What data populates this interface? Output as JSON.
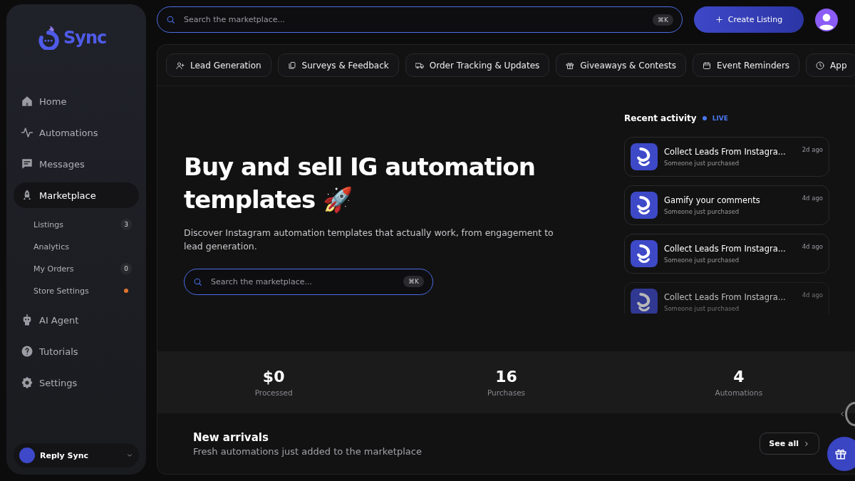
{
  "sidebar": {
    "logo": "Sync",
    "items": [
      {
        "label": "Home",
        "selected": false
      },
      {
        "label": "Automations",
        "selected": false
      },
      {
        "label": "Messages",
        "selected": false
      },
      {
        "label": "Marketplace",
        "selected": true,
        "children": [
          {
            "label": "Listings",
            "badge": "3",
            "dot": false
          },
          {
            "label": "Analytics",
            "dot": false
          },
          {
            "label": "My Orders",
            "badge": "0",
            "dot": false
          },
          {
            "label": "Store Settings",
            "dot": true
          }
        ]
      },
      {
        "label": "AI Agent",
        "selected": false
      },
      {
        "label": "Tutorials",
        "selected": false
      },
      {
        "label": "Settings",
        "selected": false
      }
    ],
    "account": {
      "name": "Reply Sync"
    }
  },
  "topbar": {
    "search": {
      "placeholder": "Search the marketplace...",
      "shortcut": "⌘K"
    },
    "create_button": "Create Listing"
  },
  "categories": [
    "Lead Generation",
    "Surveys & Feedback",
    "Order Tracking & Updates",
    "Giveaways & Contests",
    "Event Reminders",
    "App"
  ],
  "hero": {
    "title": "Buy and sell IG automation templates 🚀",
    "subtitle": "Discover Instagram automation templates that actually work, from engagement to lead generation.",
    "search": {
      "placeholder": "Search the marketplace...",
      "shortcut": "⌘K"
    }
  },
  "recent_activity": {
    "title": "Recent activity",
    "live": "LIVE",
    "items": [
      {
        "name": "Collect Leads From Instagra...",
        "note": "Someone just purchased",
        "time": "2d ago",
        "faded": false
      },
      {
        "name": "Gamify your comments",
        "note": "Someone just purchased",
        "time": "4d ago",
        "faded": false
      },
      {
        "name": "Collect Leads From Instagra...",
        "note": "Someone just purchased",
        "time": "4d ago",
        "faded": false
      },
      {
        "name": "Collect Leads From Instagra...",
        "note": "Someone just purchased",
        "time": "4d ago",
        "faded": true
      }
    ]
  },
  "stats": [
    {
      "value": "$0",
      "label": "Processed"
    },
    {
      "value": "16",
      "label": "Purchases"
    },
    {
      "value": "4",
      "label": "Automations"
    }
  ],
  "new_arrivals": {
    "title": "New arrivals",
    "subtitle": "Fresh automations just added to the marketplace",
    "button": "See all"
  }
}
